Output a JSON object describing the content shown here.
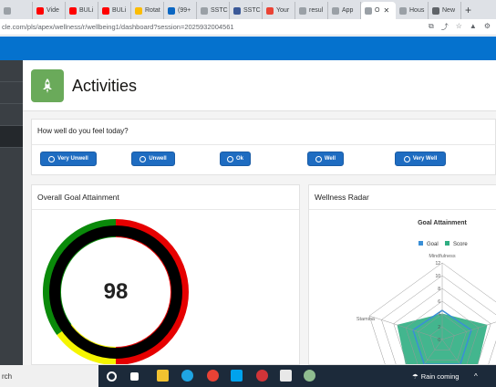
{
  "browser": {
    "tabs": [
      {
        "label": "",
        "color": "#9aa0a6"
      },
      {
        "label": "Vide",
        "color": "#ff0000"
      },
      {
        "label": "BULi",
        "color": "#ff0000"
      },
      {
        "label": "BULi",
        "color": "#ff0000"
      },
      {
        "label": "Rotat",
        "color": "#fbbc04"
      },
      {
        "label": "(99+",
        "color": "#0a66c2"
      },
      {
        "label": "SSTC",
        "color": "#9aa0a6"
      },
      {
        "label": "SSTC",
        "color": "#3b5998"
      },
      {
        "label": "Your",
        "color": "#ea4335"
      },
      {
        "label": "resul",
        "color": "#9aa0a6"
      },
      {
        "label": "App",
        "color": "#9aa0a6"
      },
      {
        "label": "O",
        "color": "#9aa0a6",
        "active": true
      },
      {
        "label": "Hous",
        "color": "#9aa0a6"
      },
      {
        "label": "New",
        "color": "#5f6368"
      }
    ],
    "new_tab": "+",
    "url": "cle.com/pls/apex/wellness/r/wellbeing1/dashboard?session=2025932004561"
  },
  "page": {
    "title": "Activities"
  },
  "feel": {
    "question": "How well do you feel today?",
    "buttons": [
      "Very Unwell",
      "Unwell",
      "Ok",
      "Well",
      "Very Well"
    ]
  },
  "goal": {
    "title": "Overall Goal Attainment",
    "value": "98",
    "segments": [
      {
        "color": "#e60000",
        "fraction": 0.5
      },
      {
        "color": "#f5f500",
        "fraction": 0.15
      },
      {
        "color": "#0a8a0a",
        "fraction": 0.35
      }
    ]
  },
  "radar": {
    "title": "Wellness Radar",
    "chart_title": "Goal Attainment",
    "legend": [
      {
        "name": "Goal",
        "color": "#3a8fd6"
      },
      {
        "name": "Score",
        "color": "#2fae82"
      }
    ],
    "axes": [
      "Mindfulness",
      "Stamina"
    ],
    "ticks": [
      "12",
      "10",
      "8",
      "6",
      "4",
      "2",
      "0"
    ]
  },
  "taskbar": {
    "search": "rch",
    "weather": "Rain coming"
  }
}
